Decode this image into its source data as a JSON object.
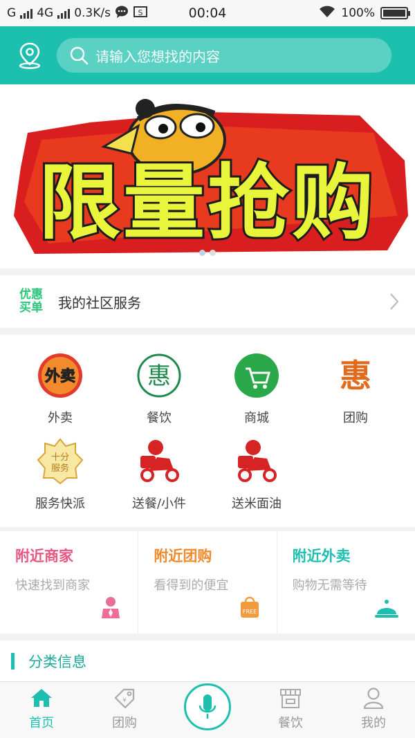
{
  "status_bar": {
    "carrier": "G",
    "network": "4G",
    "speed": "0.3K/s",
    "time": "00:04",
    "battery": "100%"
  },
  "header": {
    "search_placeholder": "请输入您想找的内容"
  },
  "banner": {
    "text": "限量抢购",
    "slide_count": 2,
    "active_slide": 1
  },
  "community": {
    "badge_line1": "优惠",
    "badge_line2": "买单",
    "title": "我的社区服务"
  },
  "categories": [
    {
      "label": "外卖",
      "icon": "takeout-icon"
    },
    {
      "label": "餐饮",
      "icon": "dining-icon"
    },
    {
      "label": "商城",
      "icon": "mall-cart-icon"
    },
    {
      "label": "团购",
      "icon": "group-buy-icon"
    },
    {
      "label": "服务快派",
      "icon": "service-badge-icon"
    },
    {
      "label": "送餐/小件",
      "icon": "delivery-scooter-icon"
    },
    {
      "label": "送米面油",
      "icon": "delivery-scooter-icon"
    }
  ],
  "nearby": [
    {
      "title": "附近商家",
      "subtitle": "快速找到商家",
      "color": "#e8577f",
      "icon": "merchant-person-icon"
    },
    {
      "title": "附近团购",
      "subtitle": "看得到的便宜",
      "color": "#f08a2a",
      "icon": "shopping-bag-icon"
    },
    {
      "title": "附近外卖",
      "subtitle": "购物无需等待",
      "color": "#1dbfae",
      "icon": "food-cloche-icon"
    }
  ],
  "section": {
    "title": "分类信息"
  },
  "tabs": [
    {
      "label": "首页",
      "icon": "home-icon",
      "active": true
    },
    {
      "label": "团购",
      "icon": "coupon-tag-icon",
      "active": false
    },
    {
      "label": "",
      "icon": "microphone-icon",
      "active": false
    },
    {
      "label": "餐饮",
      "icon": "store-icon",
      "active": false
    },
    {
      "label": "我的",
      "icon": "user-icon",
      "active": false
    }
  ],
  "colors": {
    "brand": "#1dbfae",
    "community_badge": "#2ac77a"
  }
}
